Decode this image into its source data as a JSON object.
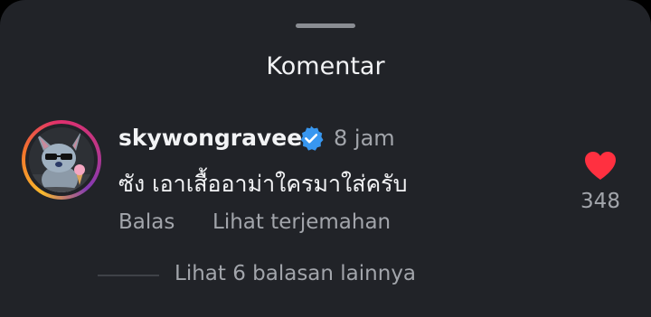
{
  "sheet": {
    "title": "Komentar"
  },
  "comment": {
    "username": "skywongravee",
    "verified": true,
    "time": "8 jam",
    "text": "ซัง เอาเสื้ออาม่าใครมาใส่ครับ",
    "actions": {
      "reply_label": "Balas",
      "translate_label": "Lihat terjemahan"
    },
    "likes": "348",
    "liked": true,
    "view_replies_label": "Lihat 6 balasan lainnya"
  },
  "colors": {
    "background": "#212328",
    "text_primary": "#f2f3f5",
    "text_secondary": "#a2a5ab",
    "verified_blue": "#3897f0",
    "like_red": "#ff3040"
  },
  "icons": {
    "verified": "verified-badge-icon",
    "like": "heart-icon",
    "avatar": "avatar"
  }
}
